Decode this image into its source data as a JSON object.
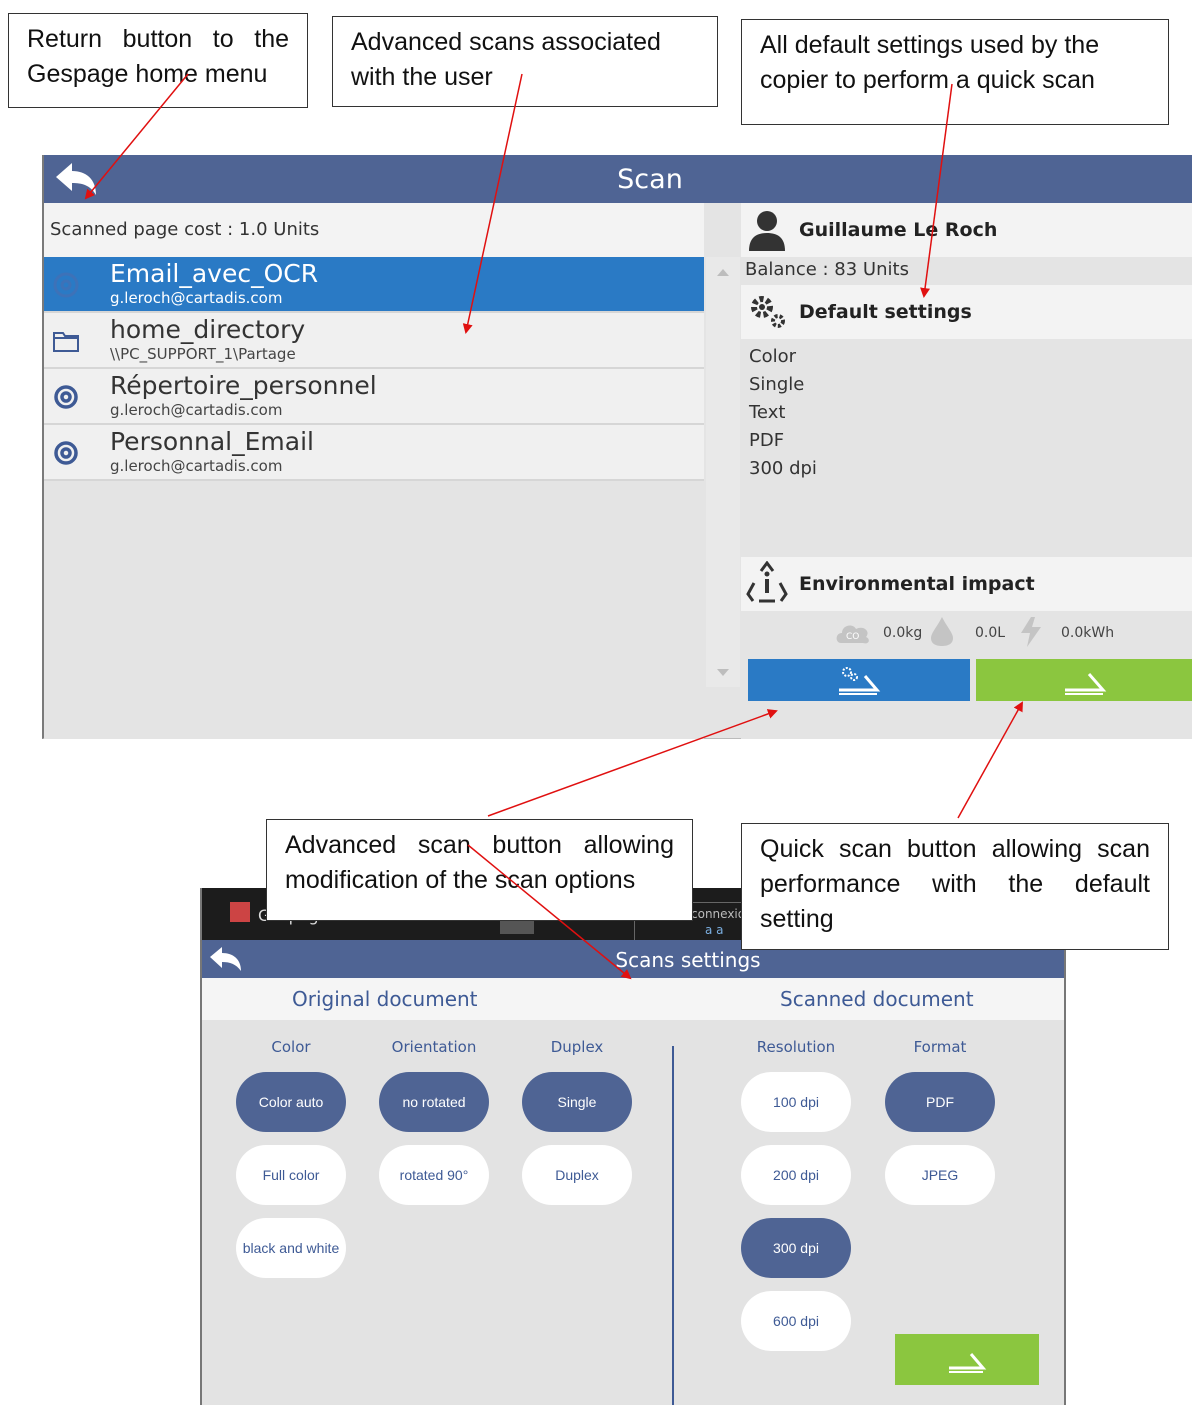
{
  "callouts": {
    "return": "Return button to the Gespage home menu",
    "advanced_scans": "Advanced scans associated with the user",
    "defaults": "All default settings used by the copier to perform a quick scan",
    "advanced_button": "Advanced scan button allowing modification of the scan options",
    "quick_button": "Quick scan button allowing scan performance with the default setting"
  },
  "scan": {
    "title": "Scan",
    "page_cost": "Scanned page cost : 1.0 Units",
    "items": [
      {
        "name": "Email_avec_OCR",
        "sub": "g.leroch@cartadis.com",
        "icon": "at-icon",
        "selected": true
      },
      {
        "name": "home_directory",
        "sub": "\\\\PC_SUPPORT_1\\Partage",
        "icon": "folder-icon",
        "selected": false
      },
      {
        "name": "Répertoire_personnel",
        "sub": "g.leroch@cartadis.com",
        "icon": "at-icon",
        "selected": false
      },
      {
        "name": "Personnal_Email",
        "sub": "g.leroch@cartadis.com",
        "icon": "at-icon",
        "selected": false
      }
    ],
    "user": "Guillaume Le Roch",
    "balance": "Balance : 83 Units",
    "default_settings_label": "Default settings",
    "defaults": [
      "Color",
      "Single",
      "Text",
      "PDF",
      "300 dpi"
    ],
    "environmental_label": "Environmental impact",
    "env": {
      "co2": "0.0kg",
      "water": "0.0L",
      "energy": "0.0kWh"
    }
  },
  "settings": {
    "os_app": "Gespage",
    "os_box": "connexio",
    "os_box_sub": "a a",
    "title": "Scans settings",
    "tab_original": "Original document",
    "tab_scanned": "Scanned document",
    "columns": {
      "color": {
        "label": "Color",
        "options": [
          "Color auto",
          "Full color",
          "black and white"
        ],
        "selected": "Color auto"
      },
      "orientation": {
        "label": "Orientation",
        "options": [
          "no rotated",
          "rotated 90°"
        ],
        "selected": "no rotated"
      },
      "duplex": {
        "label": "Duplex",
        "options": [
          "Single",
          "Duplex"
        ],
        "selected": "Single"
      },
      "resolution": {
        "label": "Resolution",
        "options": [
          "100 dpi",
          "200 dpi",
          "300 dpi",
          "600 dpi"
        ],
        "selected": "300 dpi"
      },
      "format": {
        "label": "Format",
        "options": [
          "PDF",
          "JPEG"
        ],
        "selected": "PDF"
      }
    }
  },
  "colors": {
    "header": "#4f6494",
    "selected_row": "#2a7ac5",
    "quick_scan": "#8bc63f",
    "arrow": "#e01010"
  }
}
